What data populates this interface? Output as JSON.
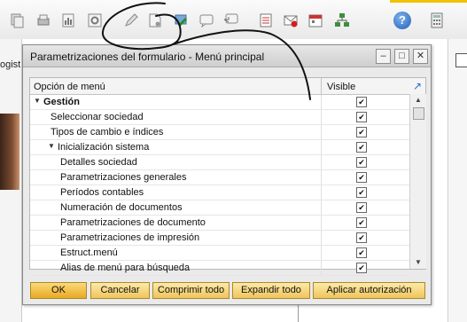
{
  "toolbar": {
    "icons": [
      "copy-icon",
      "print-preview-icon",
      "report-icon",
      "settings-icon",
      "edit-icon",
      "document-settings-icon",
      "export-icon",
      "message-icon",
      "message-reply-icon",
      "checklist-icon",
      "email-icon",
      "calendar-icon",
      "tree-icon",
      "help-icon",
      "calculator-icon"
    ],
    "help_label": "?"
  },
  "background": {
    "left_text": "ogist"
  },
  "dialog": {
    "title": "Parametrizaciones del formulario - Menú principal",
    "columns": {
      "option": "Opción de menú",
      "visible": "Visible"
    },
    "rows": [
      {
        "label": "Gestión",
        "level": 0,
        "expander": "down",
        "bold": true,
        "visible": true
      },
      {
        "label": "Seleccionar sociedad",
        "level": 1,
        "expander": "",
        "bold": false,
        "visible": true
      },
      {
        "label": "Tipos de cambio e índices",
        "level": 1,
        "expander": "",
        "bold": false,
        "visible": true
      },
      {
        "label": "Inicialización sistema",
        "level": 1,
        "expander": "down",
        "bold": false,
        "visible": true
      },
      {
        "label": "Detalles sociedad",
        "level": 2,
        "expander": "",
        "bold": false,
        "visible": true
      },
      {
        "label": "Parametrizaciones generales",
        "level": 2,
        "expander": "",
        "bold": false,
        "visible": true
      },
      {
        "label": "Períodos contables",
        "level": 2,
        "expander": "",
        "bold": false,
        "visible": true
      },
      {
        "label": "Numeración de documentos",
        "level": 2,
        "expander": "",
        "bold": false,
        "visible": true
      },
      {
        "label": "Parametrizaciones de documento",
        "level": 2,
        "expander": "",
        "bold": false,
        "visible": true
      },
      {
        "label": "Parametrizaciones de impresión",
        "level": 2,
        "expander": "",
        "bold": false,
        "visible": true
      },
      {
        "label": "Estruct.menú",
        "level": 2,
        "expander": "",
        "bold": false,
        "visible": true
      },
      {
        "label": "Alias de menú para búsqueda",
        "level": 2,
        "expander": "",
        "bold": false,
        "visible": true
      }
    ],
    "buttons": {
      "ok": "OK",
      "cancel": "Cancelar",
      "collapse_all": "Comprimir todo",
      "expand_all": "Expandir todo",
      "apply_authorization": "Aplicar autorización"
    },
    "window_controls": {
      "minimize": "–",
      "maximize": "□",
      "close": "✕"
    }
  },
  "colors": {
    "button_fill": "#efc55c",
    "ok_fill": "#e9a924",
    "scribble": "#111111"
  }
}
